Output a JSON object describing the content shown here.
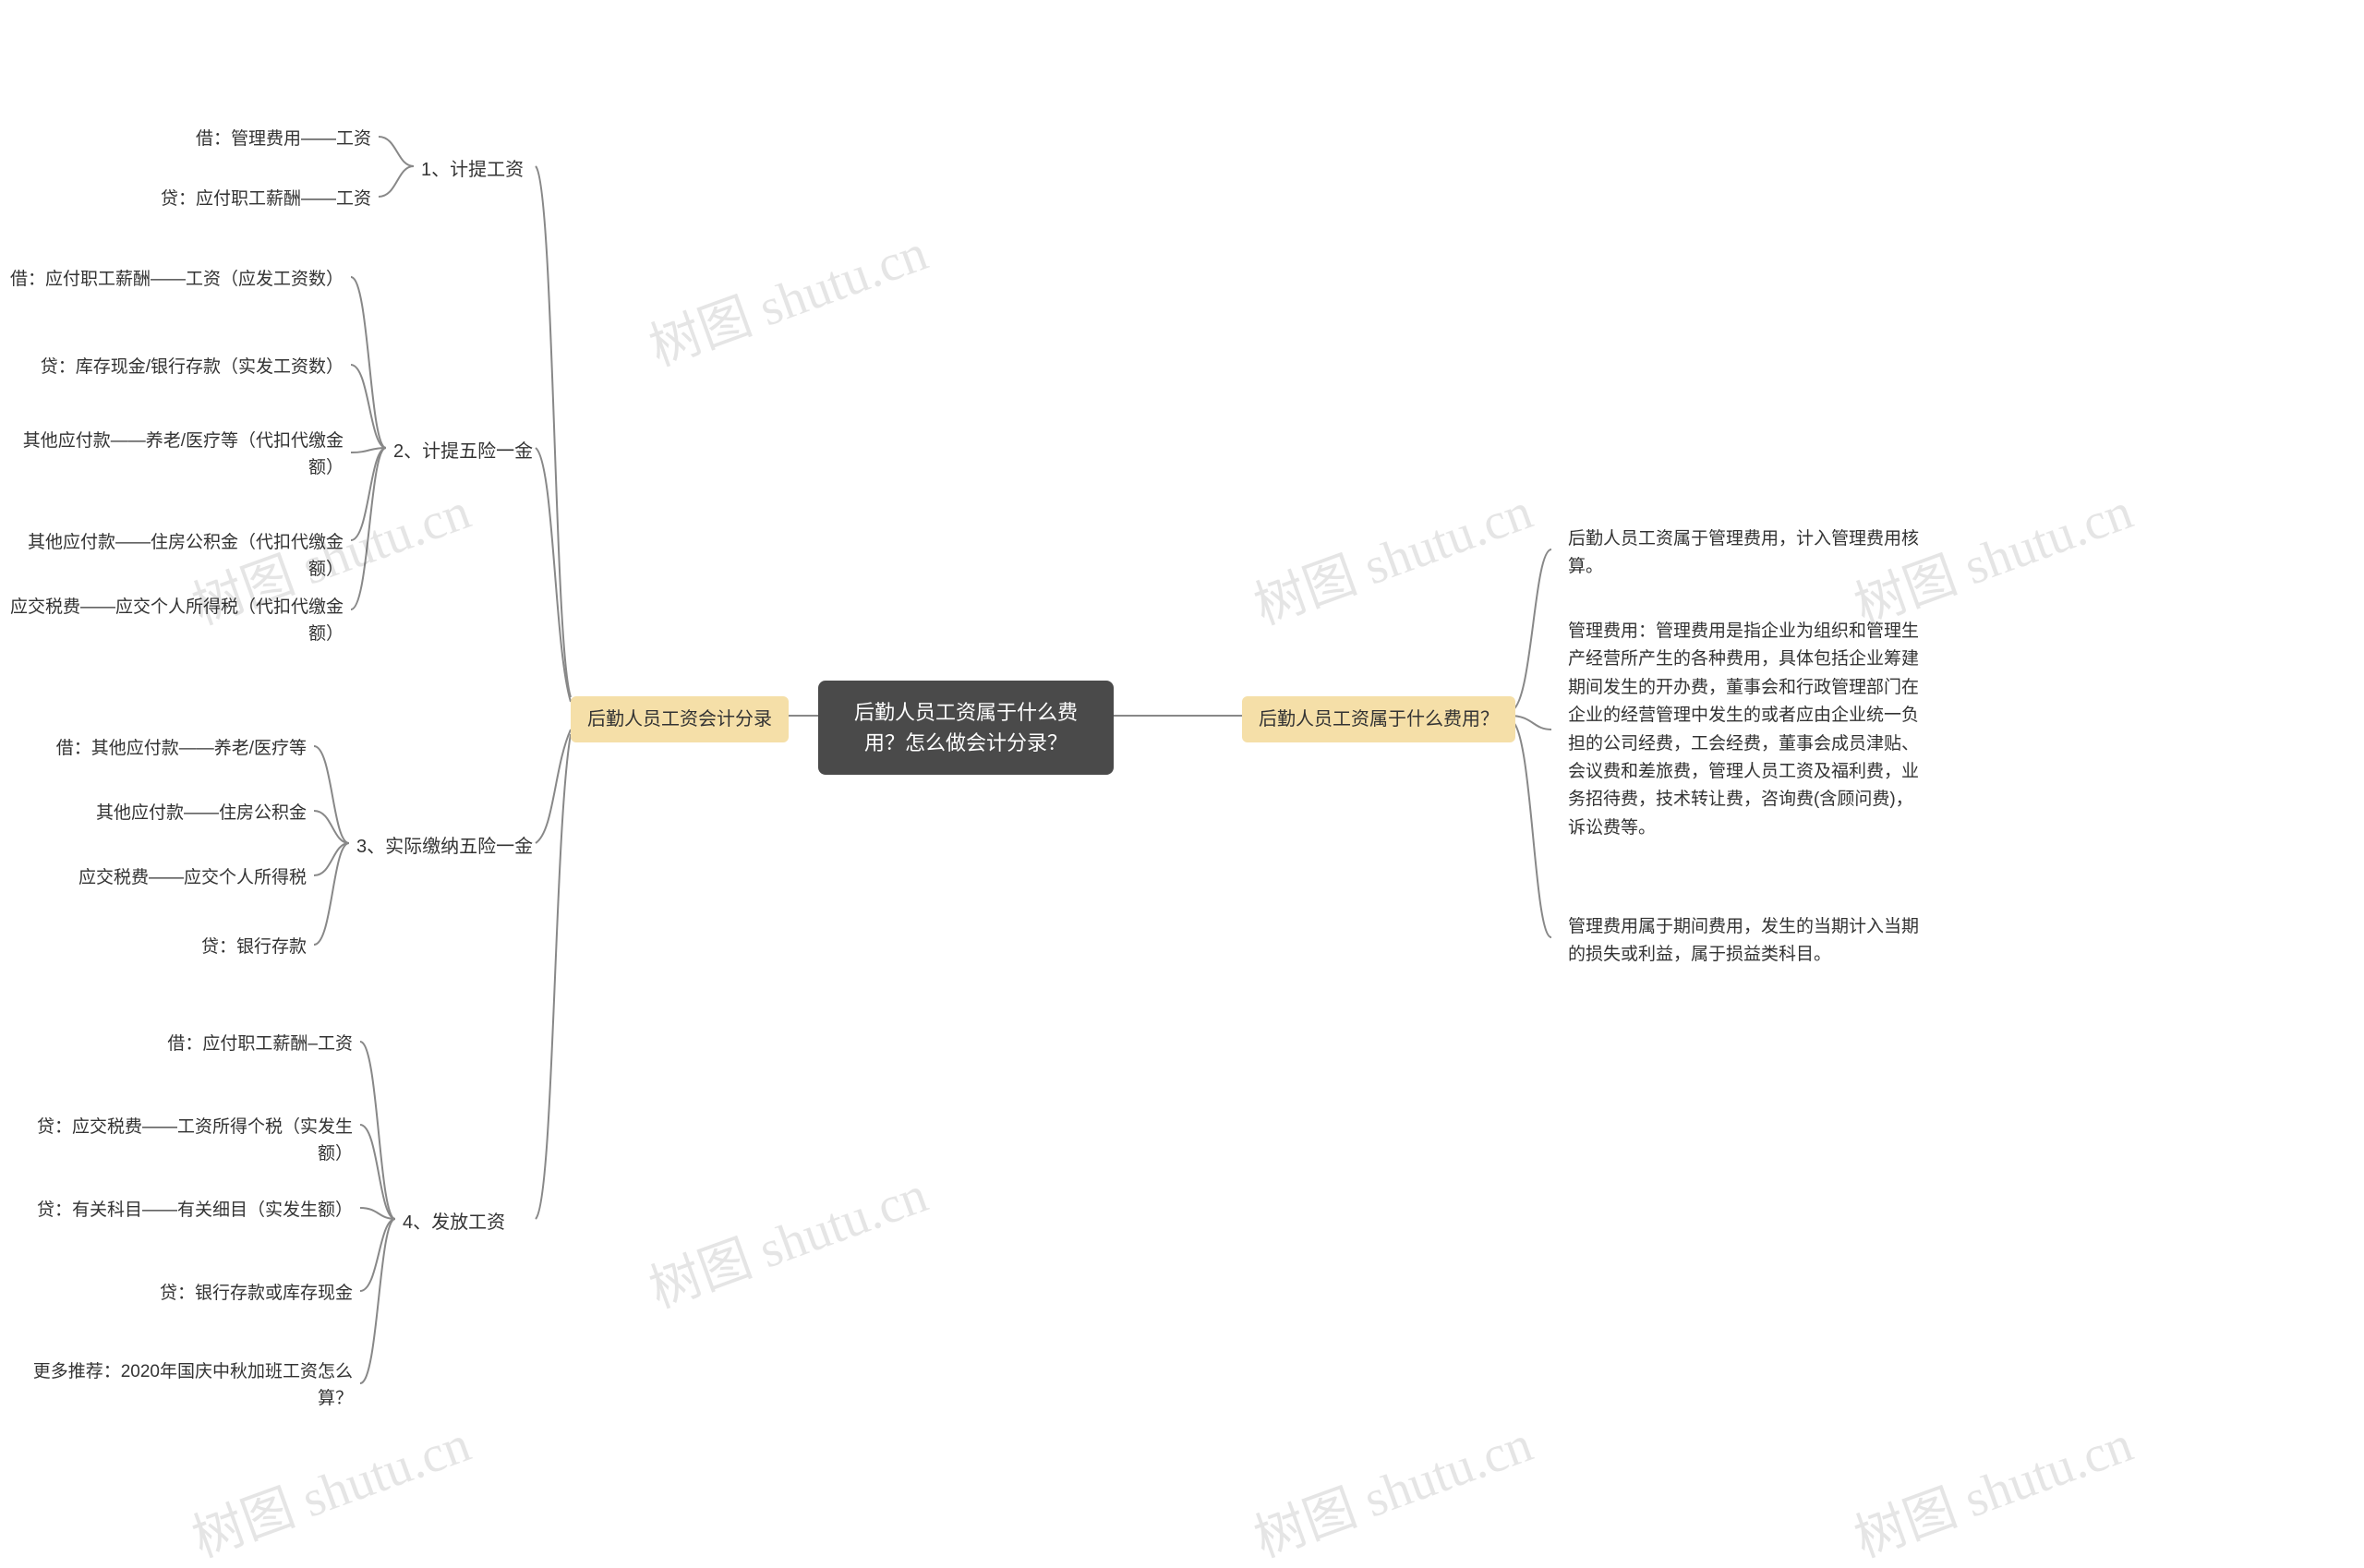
{
  "root": {
    "title": "后勤人员工资属于什么费用？怎么做会计分录？"
  },
  "left": {
    "title": "后勤人员工资会计分录",
    "groups": [
      {
        "title": "1、计提工资",
        "items": [
          "借：管理费用——工资",
          "贷：应付职工薪酬——工资"
        ]
      },
      {
        "title": "2、计提五险一金",
        "items": [
          "借：应付职工薪酬——工资（应发工资数）",
          "贷：库存现金/银行存款（实发工资数）",
          "其他应付款——养老/医疗等（代扣代缴金额）",
          "其他应付款——住房公积金（代扣代缴金额）",
          "应交税费——应交个人所得税（代扣代缴金额）"
        ]
      },
      {
        "title": "3、实际缴纳五险一金",
        "items": [
          "借：其他应付款——养老/医疗等",
          "其他应付款——住房公积金",
          "应交税费——应交个人所得税",
          "贷：银行存款"
        ]
      },
      {
        "title": "4、发放工资",
        "items": [
          "借：应付职工薪酬–工资",
          "贷：应交税费——工资所得个税（实发生额）",
          "贷：有关科目——有关细目（实发生额）",
          "贷：银行存款或库存现金",
          "更多推荐：2020年国庆中秋加班工资怎么算？"
        ]
      }
    ]
  },
  "right": {
    "title": "后勤人员工资属于什么费用？",
    "items": [
      "后勤人员工资属于管理费用，计入管理费用核算。",
      "管理费用：管理费用是指企业为组织和管理生产经营所产生的各种费用，具体包括企业筹建期间发生的开办费，董事会和行政管理部门在企业的经营管理中发生的或者应由企业统一负担的公司经费，工会经费，董事会成员津贴、会议费和差旅费，管理人员工资及福利费，业务招待费，技术转让费，咨询费(含顾问费)，诉讼费等。",
      "管理费用属于期间费用，发生的当期计入当期的损失或利益，属于损益类科目。"
    ]
  },
  "watermark": "树图 shutu.cn"
}
